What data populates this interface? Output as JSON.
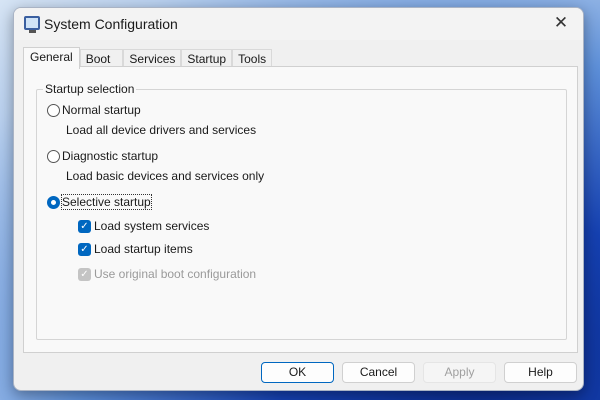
{
  "window": {
    "title": "System Configuration",
    "close": "✕"
  },
  "tabs": [
    "General",
    "Boot",
    "Services",
    "Startup",
    "Tools"
  ],
  "group": {
    "label": "Startup selection",
    "normal": {
      "label": "Normal startup",
      "desc": "Load all device drivers and services"
    },
    "diagnostic": {
      "label": "Diagnostic startup",
      "desc": "Load basic devices and services only"
    },
    "selective": {
      "label": "Selective startup",
      "options": [
        {
          "label": "Load system services",
          "checked": true,
          "enabled": true
        },
        {
          "label": "Load startup items",
          "checked": true,
          "enabled": true
        },
        {
          "label": "Use original boot configuration",
          "checked": true,
          "enabled": false
        }
      ]
    }
  },
  "selected": "Selective startup",
  "buttons": {
    "ok": "OK",
    "cancel": "Cancel",
    "apply": "Apply",
    "help": "Help"
  },
  "check_glyph": "✓"
}
